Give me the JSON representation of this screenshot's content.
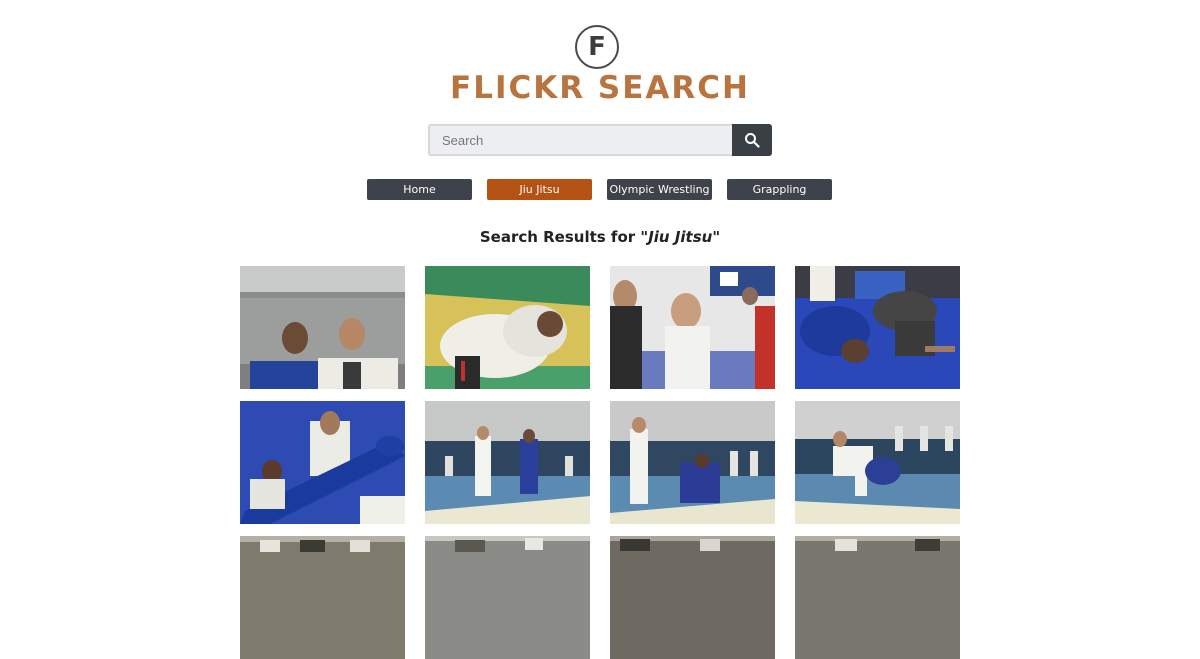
{
  "logo": {
    "mark": "F",
    "title": "FLICKR SEARCH"
  },
  "search": {
    "placeholder": "Search",
    "value": ""
  },
  "nav": {
    "home": "Home",
    "jiu_jitsu": "Jiu Jitsu",
    "olympic_wrestling": "Olympic Wrestling",
    "grappling": "Grappling"
  },
  "results": {
    "prefix": "Search Results for \"",
    "query": "Jiu Jitsu",
    "suffix": "\""
  },
  "colors": {
    "active_nav": "#b35212",
    "nav": "#3d424b",
    "logo_text": "#b8733f",
    "search_button": "#3a3f46"
  }
}
